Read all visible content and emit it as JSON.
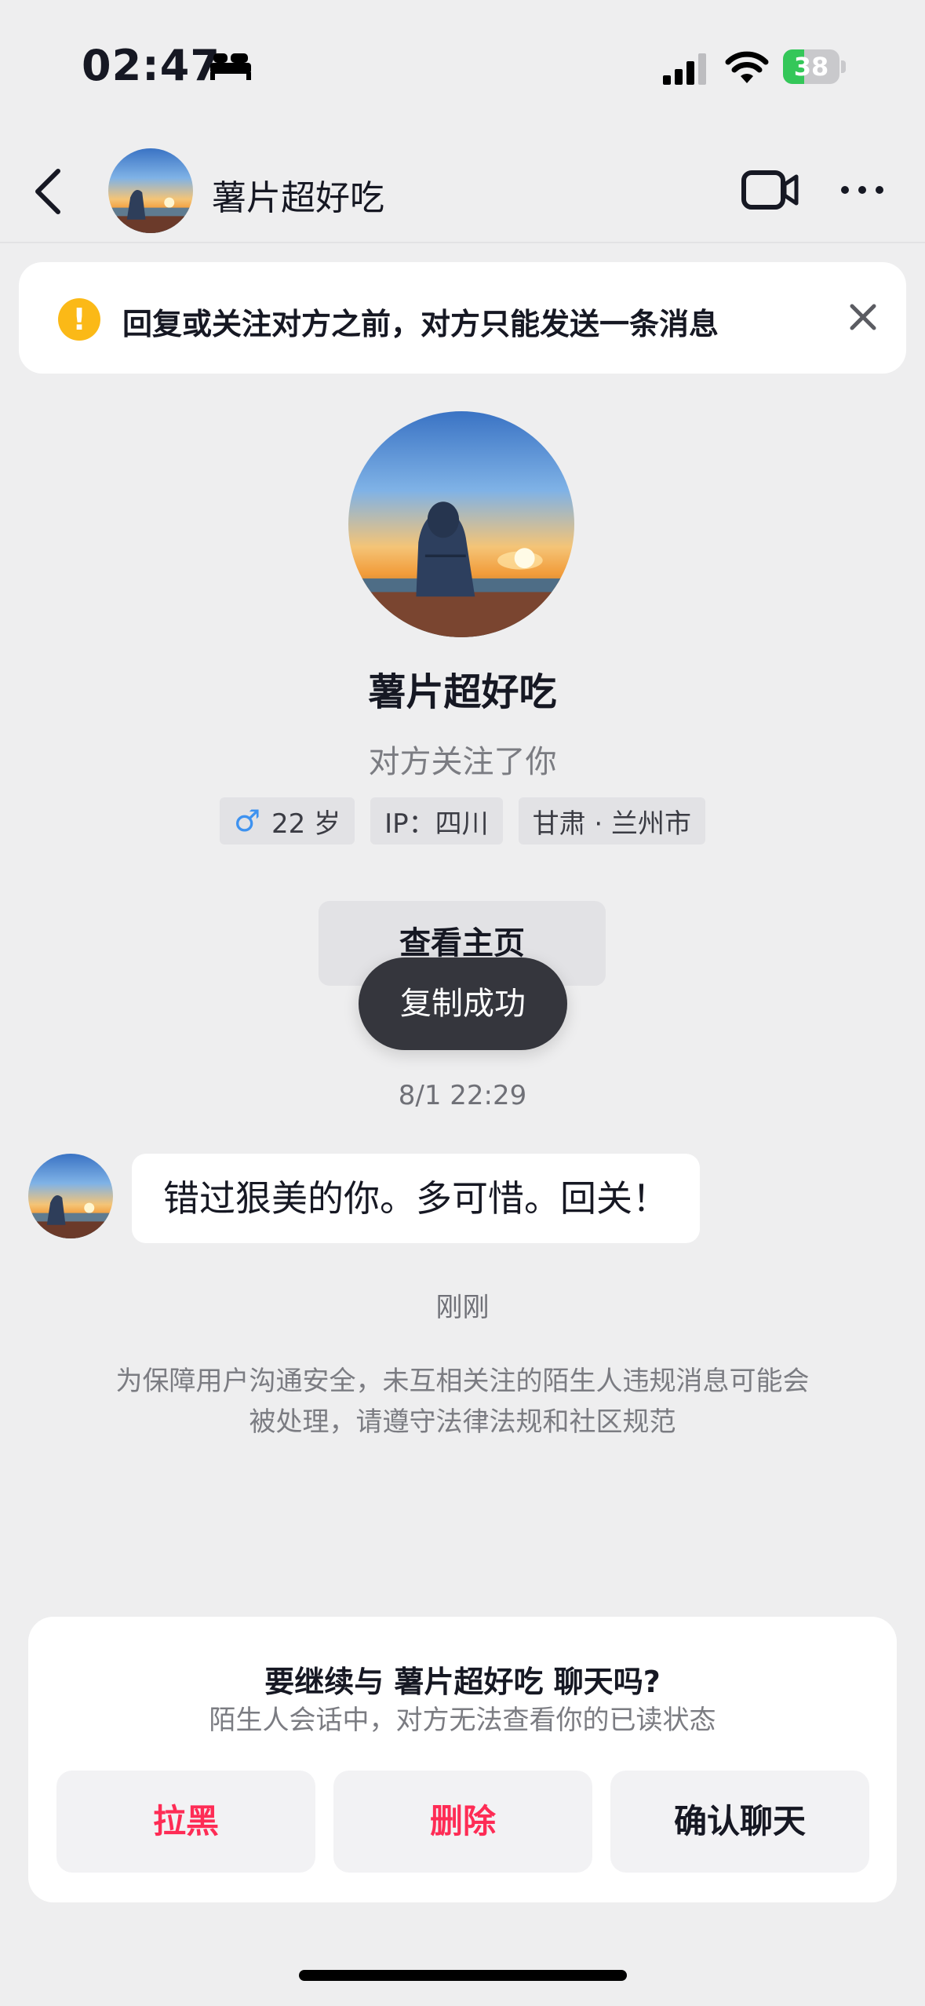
{
  "status_bar": {
    "time": "02:47",
    "battery_level": "38",
    "battery_fraction": 0.38,
    "icons": [
      "bed-icon",
      "signal-icon",
      "wifi-icon",
      "battery-icon"
    ]
  },
  "header": {
    "name": "薯片超好吃",
    "icons": [
      "back-icon",
      "video-call-icon",
      "more-icon"
    ]
  },
  "notice": {
    "text": "回复或关注对方之前，对方只能发送一条消息",
    "icons": [
      "warning-icon",
      "close-icon"
    ]
  },
  "profile": {
    "name": "薯片超好吃",
    "follow_status": "对方关注了你",
    "tags": {
      "age": "22 岁",
      "ip": "IP：四川",
      "location": "甘肃 · 兰州市"
    },
    "home_button": "查看主页"
  },
  "toast": "复制成功",
  "messages": {
    "timestamp": "8/1 22:29",
    "text": "错过狠美的你。多可惜。回关！",
    "sent_status": "刚刚"
  },
  "safety_notice": "为保障用户沟通安全，未互相关注的陌生人违规消息可能会被处理，请遵守法律法规和社区规范",
  "bottom_card": {
    "title": "要继续与 薯片超好吃 聊天吗?",
    "subtitle": "陌生人会话中，对方无法查看你的已读状态",
    "buttons": {
      "block": "拉黑",
      "delete": "删除",
      "confirm": "确认聊天"
    }
  },
  "colors": {
    "accent_red": "#fe2c55",
    "warning_yellow": "#fbb917",
    "battery_green": "#34c759",
    "background": "#eeeeef"
  }
}
